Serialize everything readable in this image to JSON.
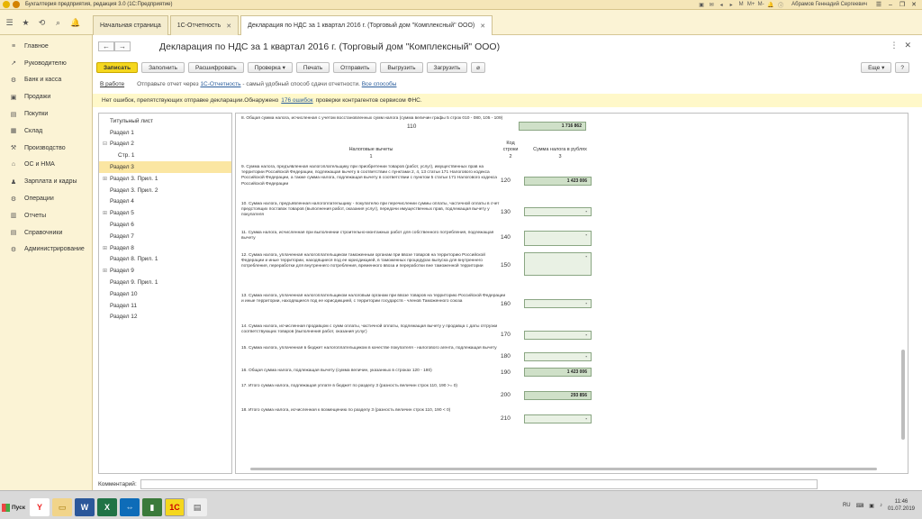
{
  "window": {
    "title": "Бухгалтерия предприятия, редакция 3.0  (1С:Предприятие)",
    "user": "Абрамов Геннадий Сергеевич"
  },
  "tabs": [
    {
      "label": "Начальная страница"
    },
    {
      "label": "1С-Отчетность"
    },
    {
      "label": "Декларация по НДС за 1 квартал 2016 г. (Торговый дом \"Комплексный\" ООО)"
    }
  ],
  "sidebar": {
    "items": [
      {
        "label": "Главное",
        "icon": "≡"
      },
      {
        "label": "Руководителю",
        "icon": "↗"
      },
      {
        "label": "Банк и касса",
        "icon": "⚙"
      },
      {
        "label": "Продажи",
        "icon": "▣"
      },
      {
        "label": "Покупки",
        "icon": "▤"
      },
      {
        "label": "Склад",
        "icon": "▦"
      },
      {
        "label": "Производство",
        "icon": "⚒"
      },
      {
        "label": "ОС и НМА",
        "icon": "⌂"
      },
      {
        "label": "Зарплата и кадры",
        "icon": "♟"
      },
      {
        "label": "Операции",
        "icon": "⚙"
      },
      {
        "label": "Отчеты",
        "icon": "▥"
      },
      {
        "label": "Справочники",
        "icon": "▤"
      },
      {
        "label": "Администрирование",
        "icon": "⚙"
      }
    ]
  },
  "main": {
    "title": "Декларация по НДС за 1 квартал 2016 г. (Торговый дом \"Комплексный\" ООО)",
    "toolbar": {
      "save": "Записать",
      "fill": "Заполнить",
      "decode": "Расшифровать",
      "check": "Проверка",
      "print": "Печать",
      "send": "Отправить",
      "upload": "Выгрузить",
      "load": "Загрузить",
      "more": "Еще",
      "help": "?"
    },
    "info": {
      "status": "В работе",
      "text_before": "Отправьте отчет через",
      "link": "1С-Отчетность",
      "text_after": "- самый удобный способ сдачи отчетности.",
      "link2": "Все способы"
    },
    "warning": {
      "before": "Нет ошибок, препятствующих отправке декларации.Обнаружено",
      "link": "176 ошибок",
      "after": "проверки контрагентов сервисом ФНС."
    },
    "comment_label": "Комментарий:"
  },
  "tree": [
    {
      "label": "Титульный лист",
      "level": 0,
      "exp": ""
    },
    {
      "label": "Раздел 1",
      "level": 0,
      "exp": ""
    },
    {
      "label": "Раздел 2",
      "level": 0,
      "exp": "⊟"
    },
    {
      "label": "Стр. 1",
      "level": 1,
      "exp": ""
    },
    {
      "label": "Раздел 3",
      "level": 0,
      "exp": "",
      "selected": true
    },
    {
      "label": "Раздел 3. Прил. 1",
      "level": 0,
      "exp": "⊞"
    },
    {
      "label": "Раздел 3. Прил. 2",
      "level": 0,
      "exp": ""
    },
    {
      "label": "Раздел 4",
      "level": 0,
      "exp": ""
    },
    {
      "label": "Раздел 5",
      "level": 0,
      "exp": "⊞"
    },
    {
      "label": "Раздел 6",
      "level": 0,
      "exp": ""
    },
    {
      "label": "Раздел 7",
      "level": 0,
      "exp": ""
    },
    {
      "label": "Раздел 8",
      "level": 0,
      "exp": "⊞"
    },
    {
      "label": "Раздел 8. Прил. 1",
      "level": 0,
      "exp": ""
    },
    {
      "label": "Раздел 9",
      "level": 0,
      "exp": "⊞"
    },
    {
      "label": "Раздел 9. Прил. 1",
      "level": 0,
      "exp": ""
    },
    {
      "label": "Раздел 10",
      "level": 0,
      "exp": ""
    },
    {
      "label": "Раздел 11",
      "level": 0,
      "exp": ""
    },
    {
      "label": "Раздел 12",
      "level": 0,
      "exp": ""
    }
  ],
  "report": {
    "header": {
      "nalog": "Налоговые вычеты",
      "nalog_num": "1",
      "code": "Код\nстроки",
      "code_num": "2",
      "sum": "Сумма налога в рублях",
      "sum_num": "3"
    },
    "rows": [
      {
        "text": "8. Общая сумма налога, исчисленная с учетом восстановленных сумм налога (сумма величин графы 5 строк 010 - 080, 105 - 109)",
        "code": "110",
        "value": "1 716 862"
      },
      {
        "text": "9. Сумма налога, предъявленная налогоплательщику при приобретении товаров (работ, услуг), имущественных прав на территории Российской Федерации, подлежащая вычету в соответствии с пунктами 2, 4, 13 статьи 171 Налогового кодекса Российской Федерации, а также сумма налога, подлежащая вычету в соответствии с пунктом 5 статьи 171 Налогового кодекса Российской Федерации",
        "code": "120",
        "value": "1 423 006"
      },
      {
        "text": "10. Сумма налога, предъявленная налогоплательщику - покупателю при перечислении суммы оплаты, частичной оплаты в счет предстоящих поставок товаров (выполнения работ, оказания услуг), передачи имущественных прав, подлежащая вычету у покупателя",
        "code": "130",
        "value": "-"
      },
      {
        "text": "11. Сумма налога, исчисленная при выполнении строительно-монтажных работ для собственного потребления, подлежащая вычету",
        "code": "140",
        "value": "-"
      },
      {
        "text": "12. Сумма налога, уплаченная налогоплательщиком таможенным органам при ввозе товаров на территорию Российской Федерации и иные территории, находящиеся под ее юрисдикцией, в таможенных процедурах выпуска для внутреннего потребления, переработки для внутреннего потребления, временного ввоза и переработки вне таможенной территории",
        "code": "150",
        "value": "-"
      },
      {
        "text": "13. Сумма налога, уплаченная налогоплательщиком налоговым органам при ввозе товаров на территорию Российской Федерации и иные территории, находящиеся под ее юрисдикцией, с территории государств - членов Таможенного союза",
        "code": "160",
        "value": "-"
      },
      {
        "text": "14. Сумма налога, исчисленная продавцом с сумм оплаты, частичной оплаты, подлежащая вычету у продавца с даты отгрузки соответствующих товаров (выполнения работ, оказания услуг)",
        "code": "170",
        "value": "-"
      },
      {
        "text": "15. Сумма налога, уплаченная в бюджет налогоплательщиком в качестве покупателя - налогового агента, подлежащая вычету",
        "code": "180",
        "value": "-"
      },
      {
        "text": "16. Общая сумма налога, подлежащая вычету (сумма величин, указанных в строках 120 - 180)",
        "code": "190",
        "value": "1 423 006"
      },
      {
        "text": "17. Итого сумма налога, подлежащая уплате в бюджет по разделу 3 (разность величин строк 110, 190 >= 0)",
        "code": "200",
        "value": "293 856"
      },
      {
        "text": "18. Итого сумма налога, исчисленная к возмещению по разделу 3 (разность величин строк 110, 190 < 0)",
        "code": "210",
        "value": "-"
      }
    ]
  },
  "taskbar": {
    "start": "Пуск",
    "lang": "RU",
    "time": "11:46",
    "date": "01.07.2019"
  }
}
